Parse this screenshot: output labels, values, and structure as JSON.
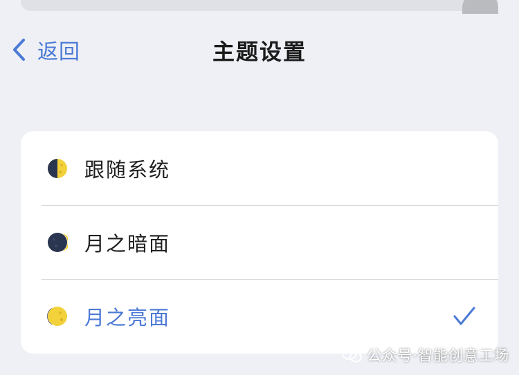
{
  "nav": {
    "back_label": "返回",
    "title": "主题设置"
  },
  "theme_options": [
    {
      "label": "跟随系统",
      "icon": "half-moon-icon",
      "selected": false
    },
    {
      "label": "月之暗面",
      "icon": "dark-moon-icon",
      "selected": false
    },
    {
      "label": "月之亮面",
      "icon": "bright-moon-icon",
      "selected": true
    }
  ],
  "watermark": {
    "text": "公众号·智能创意工场",
    "icon": "wechat-icon"
  },
  "colors": {
    "accent": "#4b79d6",
    "background": "#eef0f5",
    "card": "#ffffff",
    "moon_dark": "#2a3550",
    "moon_light": "#f2d13a"
  }
}
